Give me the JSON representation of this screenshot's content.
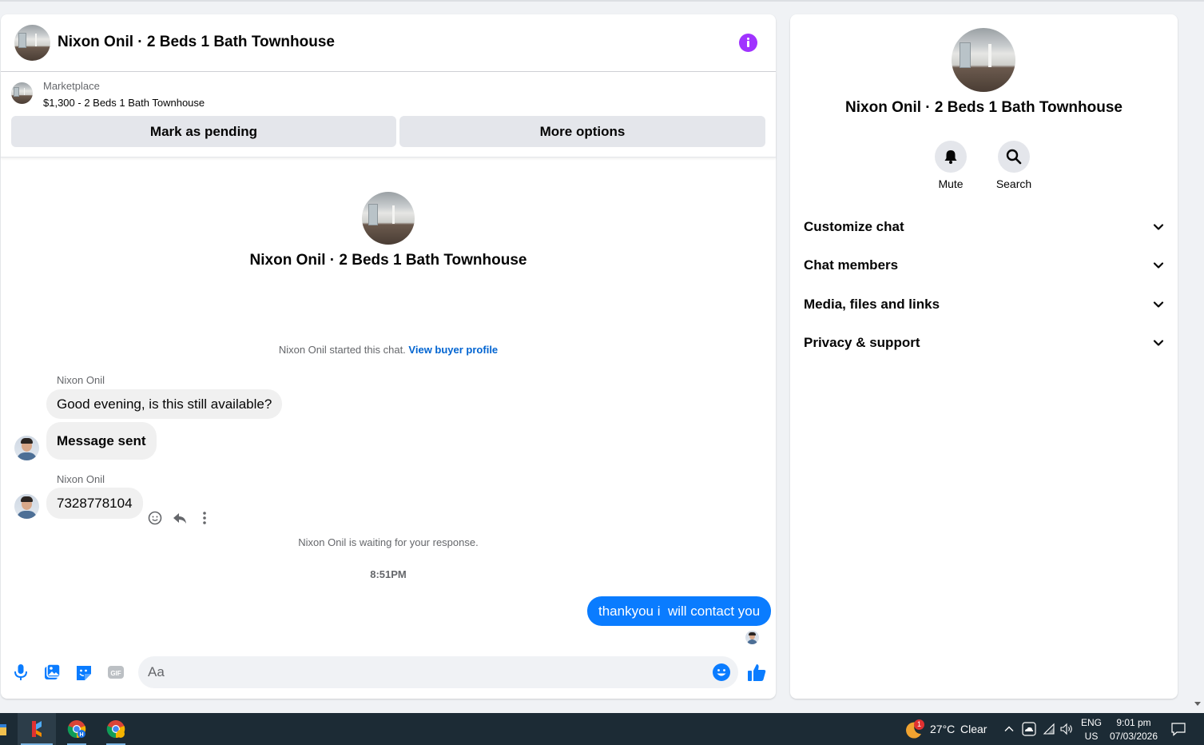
{
  "conversation": {
    "title": "Nixon Onil · 2 Beds 1 Bath Townhouse"
  },
  "marketplace": {
    "label": "Marketplace",
    "listing": "$1,300 - 2 Beds 1 Bath Townhouse",
    "mark_pending_label": "Mark as pending",
    "more_options_label": "More options"
  },
  "intro": {
    "title": "Nixon Onil · 2 Beds 1 Bath Townhouse",
    "started_text": "Nixon Onil started this chat.",
    "view_profile_link": "View buyer profile"
  },
  "messages": {
    "group1_sender": "Nixon Onil",
    "group1_msg1": "Good evening, is this still available?",
    "group1_msg2": "Message sent",
    "group2_sender": "Nixon Onil",
    "group2_msg1": "7328778104",
    "waiting_text": "Nixon Onil is waiting for your response.",
    "timestamp": "8:51PM",
    "outgoing_msg": "thankyou i  will contact you"
  },
  "composer": {
    "placeholder": "Aa"
  },
  "details": {
    "title": "Nixon Onil · 2 Beds 1 Bath Townhouse",
    "mute_label": "Mute",
    "search_label": "Search",
    "sections": [
      "Customize chat",
      "Chat members",
      "Media, files and links",
      "Privacy & support"
    ]
  },
  "taskbar": {
    "weather_temp": "27°C",
    "weather_desc": "Clear",
    "weather_badge": "1",
    "lang_line1": "ENG",
    "lang_line2": "US",
    "clock_time": "9:01 pm",
    "clock_date": "07/03/2026"
  },
  "colors": {
    "accent_blue": "#0a7cff",
    "info_purple": "#a033ff",
    "link_blue": "#0064d1",
    "taskbar": "#1c2b35"
  }
}
